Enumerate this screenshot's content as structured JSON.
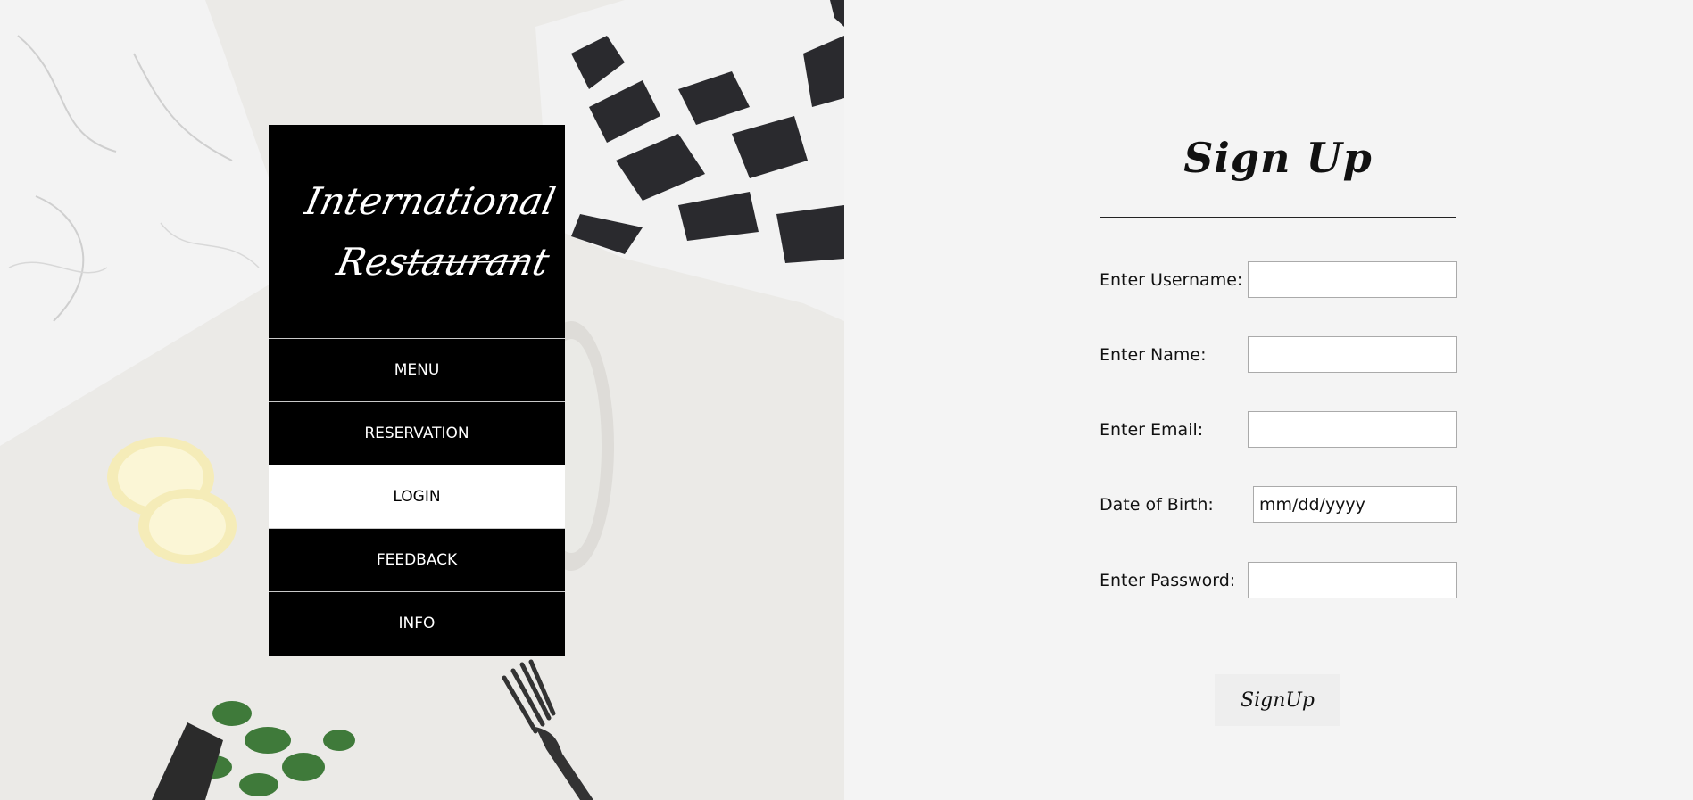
{
  "brand": {
    "line1": "International",
    "line2": "Restaurant"
  },
  "nav": {
    "items": [
      {
        "label": "MENU"
      },
      {
        "label": "RESERVATION"
      },
      {
        "label": "LOGIN"
      },
      {
        "label": "FEEDBACK"
      },
      {
        "label": "INFO"
      }
    ]
  },
  "form": {
    "title": "Sign Up",
    "fields": {
      "username": {
        "label": "Enter Username:",
        "value": ""
      },
      "name": {
        "label": "Enter Name:",
        "value": ""
      },
      "email": {
        "label": "Enter Email:",
        "value": ""
      },
      "dob": {
        "label": "Date of Birth:",
        "placeholder": "mm/dd/yyyy"
      },
      "password": {
        "label": "Enter Password:",
        "value": ""
      }
    },
    "submit_label": "SignUp"
  },
  "colors": {
    "nav_bg": "#000000",
    "nav_active_bg": "#ffffff",
    "form_bg": "#f4f4f4"
  }
}
